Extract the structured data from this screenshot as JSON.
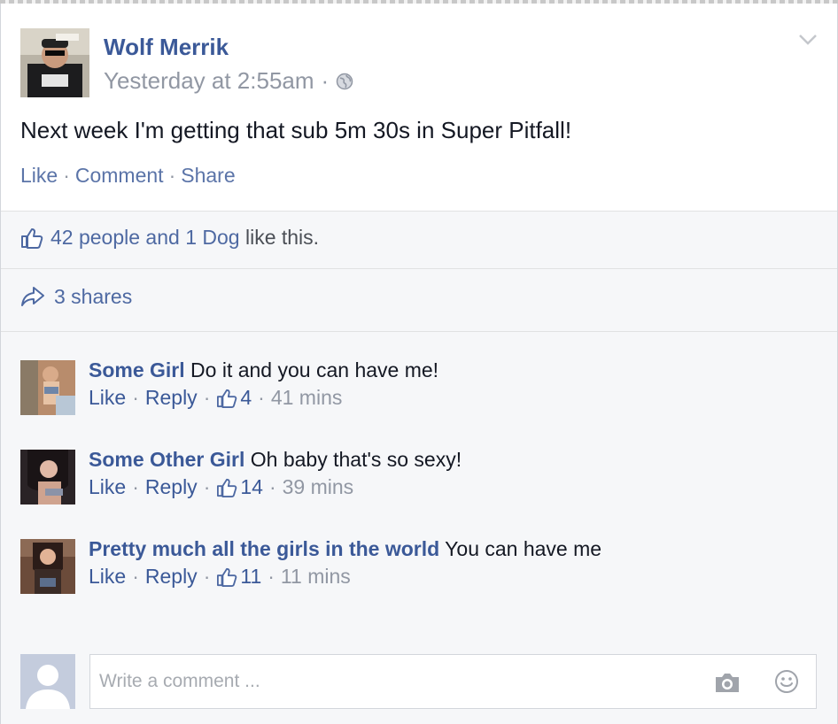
{
  "post": {
    "author": "Wolf Merrik",
    "timestamp": "Yesterday at 2:55am",
    "meta_separator": "·",
    "privacy_icon": "globe-icon",
    "text": "Next week I'm getting that sub 5m 30s in Super Pitfall!",
    "actions": {
      "like": "Like",
      "comment": "Comment",
      "share": "Share",
      "separator": "·"
    },
    "options_icon": "chevron-down-icon"
  },
  "likes": {
    "icon": "thumbs-up-icon",
    "link_text": "42 people and 1 Dog",
    "suffix": " like this."
  },
  "shares": {
    "icon": "share-arrow-icon",
    "text": "3 shares"
  },
  "comments": [
    {
      "author": "Some Girl",
      "text": "Do it and you can have me!",
      "like": "Like",
      "reply": "Reply",
      "likes": "4",
      "time": "41 mins"
    },
    {
      "author": "Some Other Girl",
      "text": "Oh baby that's so sexy!",
      "like": "Like",
      "reply": "Reply",
      "likes": "14",
      "time": "39 mins"
    },
    {
      "author": "Pretty much all the girls in the world",
      "text": "You can have me",
      "like": "Like",
      "reply": "Reply",
      "likes": "11",
      "time": "11 mins"
    }
  ],
  "composer": {
    "placeholder": "Write a comment ...",
    "photo_icon": "camera-icon",
    "emoji_icon": "smiley-icon"
  },
  "colors": {
    "link": "#3b5998",
    "muted": "#9197a3",
    "feedback_bg": "#f6f7f9"
  }
}
